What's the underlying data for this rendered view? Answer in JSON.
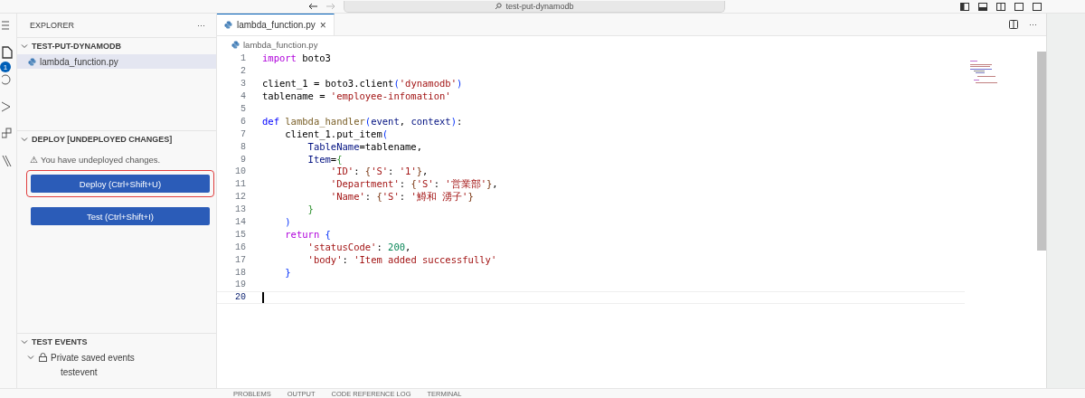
{
  "title_bar": {
    "search_text": "test-put-dynamodb"
  },
  "activity_bar": {
    "explorer_badge": "1"
  },
  "sidebar": {
    "title": "EXPLORER",
    "more": "···",
    "explorer": {
      "title": "TEST-PUT-DYNAMODB",
      "expanded": true,
      "files": [
        {
          "name": "lambda_function.py",
          "selected": true
        }
      ]
    },
    "deploy": {
      "title": "DEPLOY [UNDEPLOYED CHANGES]",
      "expanded": true,
      "warning_icon": "⚠",
      "warning": "You have undeployed changes.",
      "buttons": [
        {
          "label": "Deploy (Ctrl+Shift+U)",
          "highlighted": true
        },
        {
          "label": "Test (Ctrl+Shift+I)",
          "highlighted": false
        }
      ]
    },
    "test_events": {
      "title": "TEST EVENTS",
      "expanded": true,
      "groups": [
        {
          "name": "Private saved events",
          "expanded": true,
          "children": [
            {
              "name": "testevent"
            }
          ]
        }
      ]
    }
  },
  "editor": {
    "tabs": [
      {
        "label": "lambda_function.py",
        "selected": true,
        "close": "×"
      }
    ],
    "more": "···",
    "breadcrumb": "lambda_function.py",
    "lines": [
      {
        "number": "1",
        "current": false,
        "tokens": [
          {
            "kind": "keyword",
            "text": "import"
          },
          {
            "kind": "plain",
            "text": " boto3"
          }
        ]
      },
      {
        "number": "2",
        "current": false
      },
      {
        "number": "3",
        "current": false,
        "tokens": [
          {
            "kind": "plain",
            "text": "client_1 = boto3.client"
          },
          {
            "kind": "bracket1",
            "text": "("
          },
          {
            "kind": "string",
            "text": "'dynamodb'"
          },
          {
            "kind": "bracket1",
            "text": ")"
          }
        ]
      },
      {
        "number": "4",
        "current": false,
        "tokens": [
          {
            "kind": "plain",
            "text": "tablename = "
          },
          {
            "kind": "string",
            "text": "'employee-infomation'"
          }
        ]
      },
      {
        "number": "5",
        "current": false
      },
      {
        "number": "6",
        "current": false,
        "tokens": [
          {
            "kind": "storage",
            "text": "def "
          },
          {
            "kind": "function",
            "text": "lambda_handler"
          },
          {
            "kind": "bracket1",
            "text": "("
          },
          {
            "kind": "variable",
            "text": "event"
          },
          {
            "kind": "plain",
            "text": ", "
          },
          {
            "kind": "variable",
            "text": "context"
          },
          {
            "kind": "bracket1",
            "text": ")"
          },
          {
            "kind": "plain",
            "text": ":"
          }
        ]
      },
      {
        "number": "7",
        "current": false,
        "tokens": [
          {
            "kind": "plain",
            "text": "    client_1.put_item"
          },
          {
            "kind": "bracket1",
            "text": "("
          }
        ]
      },
      {
        "number": "8",
        "current": false,
        "tokens": [
          {
            "kind": "variable",
            "text": "        TableName"
          },
          {
            "kind": "plain",
            "text": "=tablename,"
          }
        ]
      },
      {
        "number": "9",
        "current": false,
        "tokens": [
          {
            "kind": "variable",
            "text": "        Item"
          },
          {
            "kind": "plain",
            "text": "="
          },
          {
            "kind": "bracket2",
            "text": "{"
          }
        ]
      },
      {
        "number": "10",
        "current": false,
        "tokens": [
          {
            "kind": "string",
            "text": "            'ID'"
          },
          {
            "kind": "plain",
            "text": ": "
          },
          {
            "kind": "bracket3",
            "text": "{"
          },
          {
            "kind": "string",
            "text": "'S'"
          },
          {
            "kind": "plain",
            "text": ": "
          },
          {
            "kind": "string",
            "text": "'1'"
          },
          {
            "kind": "bracket3",
            "text": "}"
          },
          {
            "kind": "plain",
            "text": ","
          }
        ]
      },
      {
        "number": "11",
        "current": false,
        "tokens": [
          {
            "kind": "string",
            "text": "            'Department'"
          },
          {
            "kind": "plain",
            "text": ": "
          },
          {
            "kind": "bracket3",
            "text": "{"
          },
          {
            "kind": "string",
            "text": "'S'"
          },
          {
            "kind": "plain",
            "text": ": "
          },
          {
            "kind": "string",
            "text": "'営業部'"
          },
          {
            "kind": "bracket3",
            "text": "}"
          },
          {
            "kind": "plain",
            "text": ","
          }
        ]
      },
      {
        "number": "12",
        "current": false,
        "tokens": [
          {
            "kind": "string",
            "text": "            'Name'"
          },
          {
            "kind": "plain",
            "text": ": "
          },
          {
            "kind": "bracket3",
            "text": "{"
          },
          {
            "kind": "string",
            "text": "'S'"
          },
          {
            "kind": "plain",
            "text": ": "
          },
          {
            "kind": "string",
            "text": "'鱒和 湧子'"
          },
          {
            "kind": "bracket3",
            "text": "}"
          }
        ]
      },
      {
        "number": "13",
        "current": false,
        "tokens": [
          {
            "kind": "bracket2",
            "text": "        }"
          }
        ]
      },
      {
        "number": "14",
        "current": false,
        "tokens": [
          {
            "kind": "bracket1",
            "text": "    )"
          }
        ]
      },
      {
        "number": "15",
        "current": false,
        "tokens": [
          {
            "kind": "keyword",
            "text": "    return "
          },
          {
            "kind": "bracket1",
            "text": "{"
          }
        ]
      },
      {
        "number": "16",
        "current": false,
        "tokens": [
          {
            "kind": "string",
            "text": "        'statusCode'"
          },
          {
            "kind": "plain",
            "text": ": "
          },
          {
            "kind": "number",
            "text": "200"
          },
          {
            "kind": "plain",
            "text": ","
          }
        ]
      },
      {
        "number": "17",
        "current": false,
        "tokens": [
          {
            "kind": "string",
            "text": "        'body'"
          },
          {
            "kind": "plain",
            "text": ": "
          },
          {
            "kind": "string",
            "text": "'Item added successfully'"
          }
        ]
      },
      {
        "number": "18",
        "current": false,
        "tokens": [
          {
            "kind": "bracket1",
            "text": "    }"
          }
        ]
      },
      {
        "number": "19",
        "current": false
      },
      {
        "number": "20",
        "current": true
      }
    ]
  },
  "panel": {
    "tabs": [
      {
        "label": "PROBLEMS",
        "selected": false
      },
      {
        "label": "OUTPUT",
        "selected": false
      },
      {
        "label": "CODE REFERENCE LOG",
        "selected": false
      },
      {
        "label": "TERMINAL",
        "selected": false
      }
    ]
  }
}
